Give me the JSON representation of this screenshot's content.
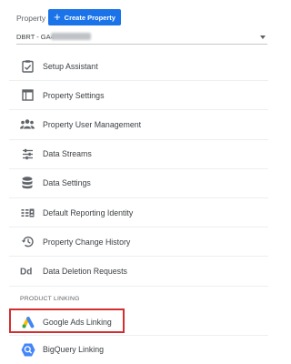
{
  "header": {
    "property_label": "Property",
    "create_button": {
      "label": "Create Property",
      "icon": "plus-icon"
    },
    "property_select": {
      "value": "DBRT - GA4"
    }
  },
  "menu": {
    "items": [
      {
        "label": "Setup Assistant",
        "icon": "checklist-icon"
      },
      {
        "label": "Property Settings",
        "icon": "window-icon"
      },
      {
        "label": "Property User Management",
        "icon": "people-icon"
      },
      {
        "label": "Data Streams",
        "icon": "streams-icon"
      },
      {
        "label": "Data Settings",
        "icon": "database-icon"
      },
      {
        "label": "Default Reporting Identity",
        "icon": "identity-icon"
      },
      {
        "label": "Property Change History",
        "icon": "history-icon"
      },
      {
        "label": "Data Deletion Requests",
        "icon": "dd-icon"
      }
    ]
  },
  "product_linking": {
    "title": "PRODUCT LINKING",
    "items": [
      {
        "label": "Google Ads Linking",
        "icon": "google-ads-icon"
      },
      {
        "label": "BigQuery Linking",
        "icon": "bigquery-icon"
      }
    ]
  },
  "colors": {
    "primary": "#1a73e8",
    "highlight": "#d32f2f",
    "text": "#3c4043",
    "icon": "#5f6368"
  }
}
